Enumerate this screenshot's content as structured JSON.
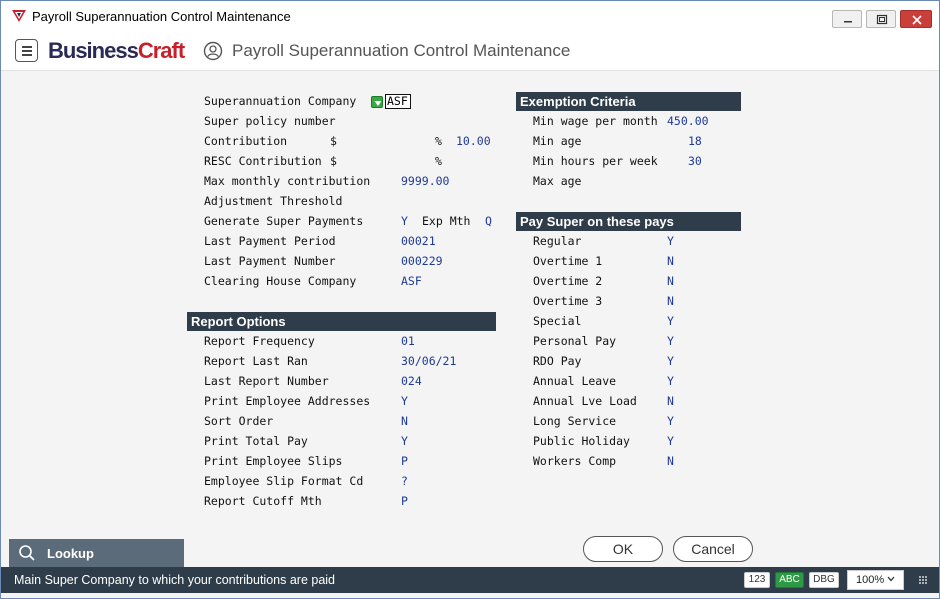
{
  "window": {
    "title": "Payroll Superannuation Control Maintenance",
    "icons": {
      "app": "payroll-app-icon",
      "minimize": "minimize-icon",
      "maximize": "maximize-icon",
      "close": "close-icon"
    }
  },
  "header": {
    "logo_part1": "Business",
    "logo_part2": "Craft",
    "page_title": "Payroll Superannuation Control Maintenance",
    "brand_colors": {
      "business": "#2b2a57",
      "craft": "#c8202b"
    }
  },
  "main": {
    "superannuation_company": {
      "label": "Superannuation Company",
      "value": "ASF"
    },
    "super_policy_number": {
      "label": "Super policy number",
      "value": ""
    },
    "contribution": {
      "label": "Contribution",
      "dollar": "$",
      "percent": "%",
      "value": "10.00"
    },
    "resc_contribution": {
      "label": "RESC Contribution",
      "dollar": "$",
      "percent": "%",
      "value": ""
    },
    "max_monthly_contribution": {
      "label": "Max monthly contribution",
      "value": "9999.00"
    },
    "adjustment_threshold": {
      "label": "Adjustment Threshold",
      "value": ""
    },
    "generate_super_payments": {
      "label": "Generate Super Payments",
      "value": "Y",
      "exp_label": "Exp Mth",
      "exp_value": "Q"
    },
    "last_payment_period": {
      "label": "Last Payment Period",
      "value": "00021"
    },
    "last_payment_number": {
      "label": "Last Payment Number",
      "value": "000229"
    },
    "clearing_house_company": {
      "label": "Clearing House Company",
      "value": "ASF"
    }
  },
  "report_options": {
    "title": "Report Options",
    "rows": [
      {
        "label": "Report Frequency",
        "value": "01"
      },
      {
        "label": "Report Last Ran",
        "value": "30/06/21"
      },
      {
        "label": "Last Report Number",
        "value": "024"
      },
      {
        "label": "Print Employee Addresses",
        "value": "Y"
      },
      {
        "label": "Sort Order",
        "value": "N"
      },
      {
        "label": "Print Total Pay",
        "value": "Y"
      },
      {
        "label": "Print Employee Slips",
        "value": "P"
      },
      {
        "label": "Employee Slip Format Cd",
        "value": "?"
      },
      {
        "label": "Report Cutoff Mth",
        "value": "P"
      }
    ]
  },
  "exemption": {
    "title": "Exemption Criteria",
    "rows": [
      {
        "label": "Min wage per month",
        "value": "450.00"
      },
      {
        "label": "Min age",
        "value": "18"
      },
      {
        "label": "Min hours per week",
        "value": "30"
      },
      {
        "label": "Max age",
        "value": ""
      }
    ]
  },
  "pay_super": {
    "title": "Pay Super on these pays",
    "rows": [
      {
        "label": "Regular",
        "value": "Y"
      },
      {
        "label": "Overtime 1",
        "value": "N"
      },
      {
        "label": "Overtime 2",
        "value": "N"
      },
      {
        "label": "Overtime 3",
        "value": "N"
      },
      {
        "label": "Special",
        "value": "Y"
      },
      {
        "label": "Personal Pay",
        "value": "Y"
      },
      {
        "label": "RDO Pay",
        "value": "Y"
      },
      {
        "label": "Annual Leave",
        "value": "Y"
      },
      {
        "label": "Annual Lve Load",
        "value": "N"
      },
      {
        "label": "Long Service",
        "value": "Y"
      },
      {
        "label": "Public Holiday",
        "value": "Y"
      },
      {
        "label": "Workers Comp",
        "value": "N"
      }
    ]
  },
  "lookup": {
    "label": "Lookup",
    "icon": "search-icon"
  },
  "buttons": {
    "ok": "OK",
    "cancel": "Cancel"
  },
  "statusbar": {
    "message": "Main Super Company to which your contributions are paid",
    "ind_123": "123",
    "ind_abc": "ABC",
    "ind_dbg": "DBG",
    "zoom": "100%",
    "abc_color": "#2f9a45"
  }
}
